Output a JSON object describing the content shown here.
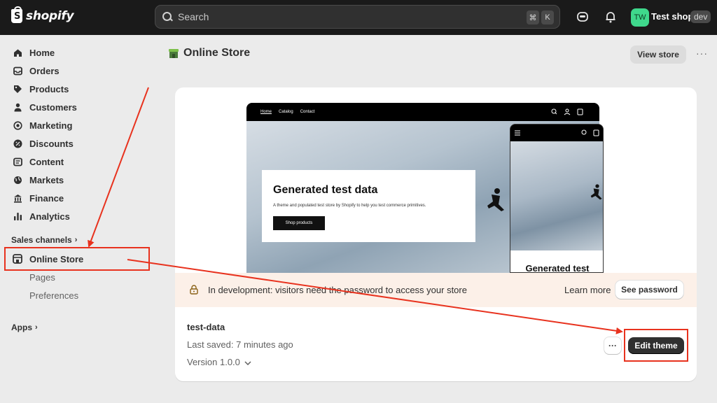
{
  "topbar": {
    "logo_text": "shopify",
    "search_placeholder": "Search",
    "shortcut_keys": [
      "⌘",
      "K"
    ],
    "avatar_initials": "TW",
    "shop_name": "Test shop",
    "env_badge": "dev",
    "avatar_color": "#3fd88c"
  },
  "sidebar": {
    "items": [
      {
        "label": "Home",
        "icon": "home-icon"
      },
      {
        "label": "Orders",
        "icon": "inbox-icon"
      },
      {
        "label": "Products",
        "icon": "tag-icon"
      },
      {
        "label": "Customers",
        "icon": "person-icon"
      },
      {
        "label": "Marketing",
        "icon": "target-icon"
      },
      {
        "label": "Discounts",
        "icon": "discount-icon"
      },
      {
        "label": "Content",
        "icon": "content-icon"
      },
      {
        "label": "Markets",
        "icon": "globe-icon"
      },
      {
        "label": "Finance",
        "icon": "bank-icon"
      },
      {
        "label": "Analytics",
        "icon": "chart-icon"
      }
    ],
    "sales_channels_label": "Sales channels",
    "online_store_label": "Online Store",
    "sub_items": [
      "Pages",
      "Preferences"
    ],
    "apps_label": "Apps"
  },
  "main": {
    "page_title": "Online Store",
    "view_store_label": "View store",
    "preview": {
      "nav_links": [
        "Home",
        "Catalog",
        "Contact"
      ],
      "hero_title": "Generated test data",
      "hero_subtitle": "A theme and populated test store by Shopify to help you test commerce primitives.",
      "hero_button": "Shop products",
      "mobile_title": "Generated test"
    },
    "notice_text": "In development: visitors need the password to access your store",
    "learn_more_label": "Learn more",
    "see_password_label": "See password",
    "theme": {
      "name": "test-data",
      "last_saved": "Last saved: 7 minutes ago",
      "version": "Version 1.0.0",
      "more_label": "···",
      "edit_label": "Edit theme"
    }
  },
  "colors": {
    "annotation": "#e8321e",
    "notice_bg": "#fcf0e8",
    "topbar_bg": "#1a1a1a"
  }
}
